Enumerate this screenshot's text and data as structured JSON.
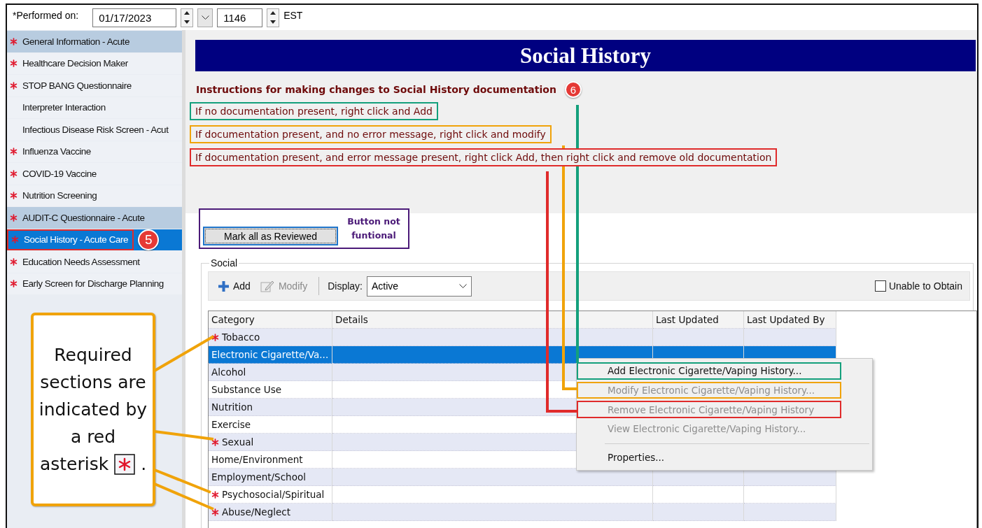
{
  "performed_on": {
    "label": "*Performed on:",
    "date": "01/17/2023",
    "time": "1146",
    "timezone": "EST"
  },
  "sidebar": {
    "items": [
      {
        "label": "General Information - Acute",
        "required": true,
        "highlighted": true,
        "selected": false
      },
      {
        "label": "Healthcare Decision Maker",
        "required": true,
        "highlighted": false,
        "selected": false
      },
      {
        "label": "STOP BANG Questionnaire",
        "required": true,
        "highlighted": false,
        "selected": false
      },
      {
        "label": "Interpreter Interaction",
        "required": false,
        "highlighted": false,
        "selected": false
      },
      {
        "label": "Infectious Disease Risk Screen - Acut",
        "required": false,
        "highlighted": false,
        "selected": false
      },
      {
        "label": "Influenza Vaccine",
        "required": true,
        "highlighted": false,
        "selected": false
      },
      {
        "label": "COVID-19 Vaccine",
        "required": true,
        "highlighted": false,
        "selected": false
      },
      {
        "label": "Nutrition Screening",
        "required": true,
        "highlighted": false,
        "selected": false
      },
      {
        "label": "AUDIT-C Questionnaire - Acute",
        "required": true,
        "highlighted": true,
        "selected": false
      },
      {
        "label": "Social History - Acute Care",
        "required": true,
        "selected": true,
        "badge": "5"
      },
      {
        "label": "Education Needs Assessment",
        "required": true,
        "highlighted": false,
        "selected": false
      },
      {
        "label": "Early Screen for Discharge Planning",
        "required": true,
        "highlighted": false,
        "selected": false
      }
    ]
  },
  "title": "Social History",
  "instructions": {
    "heading": "Instructions for making changes to Social History documentation",
    "badge": "6",
    "lines": [
      {
        "text": "If no documentation present, right click and Add",
        "color": "#14a07c"
      },
      {
        "text": "If documentation present, and no error message, right click and modify",
        "color": "#f0a30a"
      },
      {
        "text": "If documentation present, and error message present, right click Add, then right click and remove old documentation",
        "color": "#e02b2b"
      }
    ]
  },
  "review": {
    "button": "Mark all as Reviewed",
    "note": "Button not funtional"
  },
  "social": {
    "legend": "Social",
    "toolbar": {
      "add": "Add",
      "modify": "Modify",
      "modify_disabled": true,
      "display_label": "Display:",
      "display_value": "Active",
      "unable_label": "Unable to Obtain",
      "unable_checked": false
    },
    "table": {
      "columns": [
        "Category",
        "Details",
        "Last Updated",
        "Last Updated By"
      ],
      "rows": [
        {
          "category": "Tobacco",
          "required": true,
          "selected": false
        },
        {
          "category": "Electronic Cigarette/Va...",
          "required": false,
          "selected": true
        },
        {
          "category": "Alcohol",
          "required": false,
          "selected": false
        },
        {
          "category": "Substance Use",
          "required": false,
          "selected": false
        },
        {
          "category": "Nutrition",
          "required": false,
          "selected": false
        },
        {
          "category": "Exercise",
          "required": false,
          "selected": false
        },
        {
          "category": "Sexual",
          "required": true,
          "selected": false
        },
        {
          "category": "Home/Environment",
          "required": false,
          "selected": false
        },
        {
          "category": "Employment/School",
          "required": false,
          "selected": false
        },
        {
          "category": "Psychosocial/Spiritual",
          "required": true,
          "selected": false
        },
        {
          "category": "Abuse/Neglect",
          "required": true,
          "selected": false
        }
      ]
    }
  },
  "context_menu": {
    "items": [
      {
        "kind": "item",
        "label": "Add Electronic Cigarette/Vaping History...",
        "disabled": false,
        "color": "#14a07c"
      },
      {
        "kind": "item",
        "label": "Modify Electronic Cigarette/Vaping History...",
        "disabled": true,
        "color": "#f0a30a"
      },
      {
        "kind": "item",
        "label": "Remove Electronic Cigarette/Vaping History",
        "disabled": true,
        "color": "#e02b2b"
      },
      {
        "kind": "item",
        "label": "View Electronic Cigarette/Vaping History...",
        "disabled": true
      },
      {
        "kind": "separator"
      },
      {
        "kind": "item",
        "label": "Properties...",
        "disabled": false
      }
    ]
  },
  "callout": {
    "text": "Required sections are indicated by a red",
    "last_word": "asterisk",
    "end": "."
  }
}
